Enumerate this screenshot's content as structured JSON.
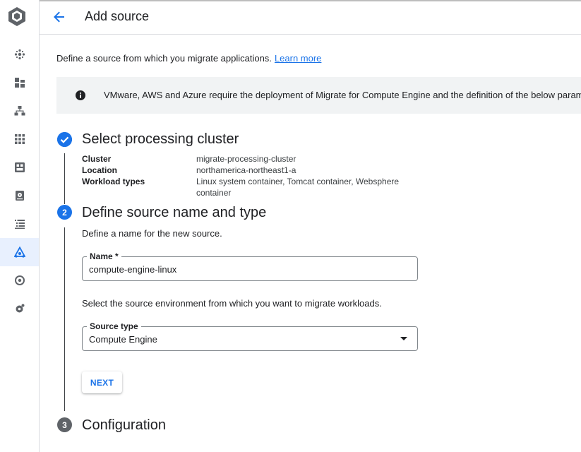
{
  "header": {
    "title": "Add source"
  },
  "intro": {
    "text": "Define a source from which you migrate applications.",
    "link": "Learn more"
  },
  "banner": {
    "text": "VMware, AWS and Azure require the deployment of Migrate for Compute Engine and the definition of the below parameters."
  },
  "steps": [
    {
      "number": "1",
      "state": "done",
      "title": "Select processing cluster",
      "summary": [
        {
          "label": "Cluster",
          "value": "migrate-processing-cluster"
        },
        {
          "label": "Location",
          "value": "northamerica-northeast1-a"
        },
        {
          "label": "Workload types",
          "value": "Linux system container, Tomcat container, Websphere container"
        }
      ]
    },
    {
      "number": "2",
      "state": "current",
      "title": "Define source name and type",
      "name_description": "Define a name for the new source.",
      "name_field": {
        "label": "Name *",
        "value": "compute-engine-linux"
      },
      "type_description": "Select the source environment from which you want to migrate workloads.",
      "type_field": {
        "label": "Source type",
        "value": "Compute Engine"
      },
      "next_label": "NEXT"
    },
    {
      "number": "3",
      "state": "future",
      "title": "Configuration"
    }
  ],
  "colors": {
    "accent": "#1a73e8",
    "active_rail_bg": "#e8f0fe",
    "banner_bg": "#f1f3f4"
  },
  "rail": {
    "logo": "product-logo-icon",
    "items": [
      "dashboard-icon",
      "discover-icon",
      "hierarchy-icon",
      "apps-grid-icon",
      "overview-icon",
      "storage-icon",
      "list-icon",
      "migrate-icon",
      "target-icon",
      "settings-icon"
    ]
  }
}
